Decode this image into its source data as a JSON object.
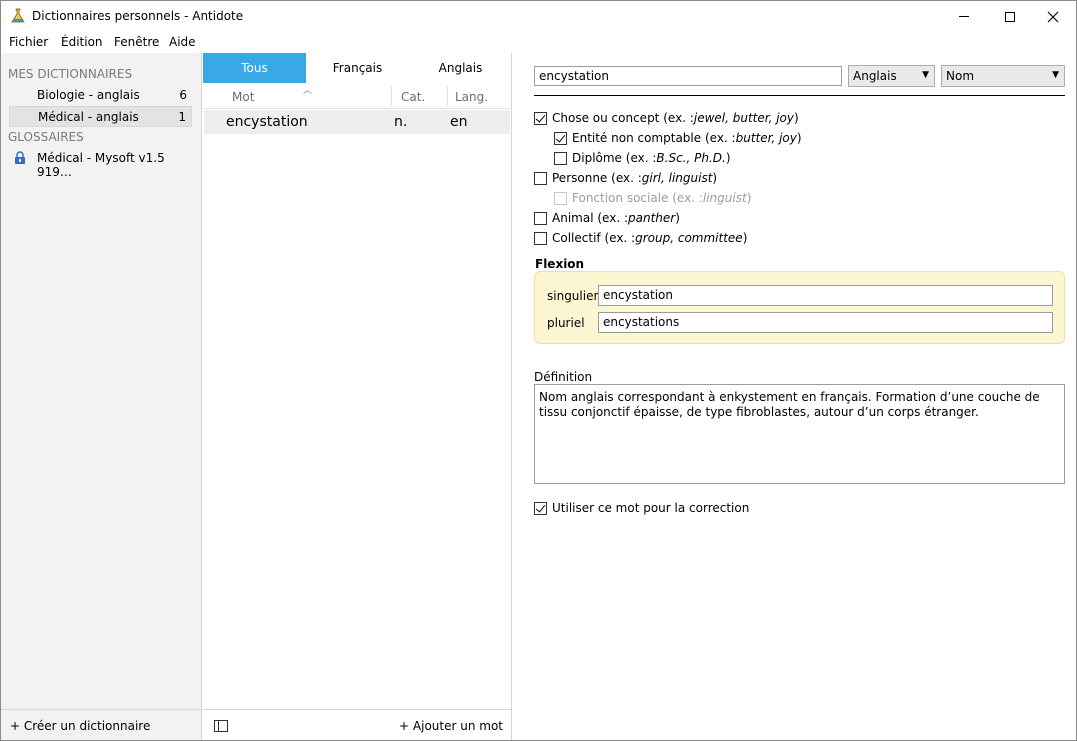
{
  "window": {
    "title": "Dictionnaires personnels - Antidote",
    "icon": "antidote-flask-icon"
  },
  "menu": {
    "fichier": "Fichier",
    "edition": "Édition",
    "fenetre": "Fenêtre",
    "aide": "Aide"
  },
  "sidebar": {
    "mes_dictionnaires_label": "MES DICTIONNAIRES",
    "dictionaries": [
      {
        "label": "Biologie - anglais",
        "count": "6"
      },
      {
        "label": "Médical - anglais",
        "count": "1"
      }
    ],
    "glossaires_label": "GLOSSAIRES",
    "glossaries": [
      {
        "label": "Médical - Mysoft v1.5  919…",
        "icon": "lock-icon"
      }
    ],
    "create_label": "+ Créer un dictionnaire"
  },
  "wordlist": {
    "tabs": [
      "Tous",
      "Français",
      "Anglais"
    ],
    "columns": {
      "mot": "Mot",
      "cat": "Cat.",
      "lang": "Lang."
    },
    "rows": [
      {
        "mot": "encystation",
        "cat": "n.",
        "lang": "en"
      }
    ],
    "add_label": "+ Ajouter un mot"
  },
  "detail": {
    "word": "encystation",
    "language": "Anglais",
    "category": "Nom",
    "semantic": {
      "chose": {
        "label": "Chose ou concept",
        "ex_prefix": "(ex. : ",
        "ex": "jewel, butter, joy",
        "ex_suffix": ")",
        "checked": true
      },
      "entite": {
        "label": "Entité non comptable",
        "ex_prefix": "(ex. : ",
        "ex": "butter, joy",
        "ex_suffix": ")",
        "checked": true
      },
      "diplome": {
        "label": "Diplôme",
        "ex_prefix": "(ex. : ",
        "ex": "B.Sc., Ph.D.",
        "ex_suffix": ")",
        "checked": false
      },
      "personne": {
        "label": "Personne",
        "ex_prefix": "(ex. : ",
        "ex": "girl, linguist",
        "ex_suffix": ")",
        "checked": false
      },
      "fonction": {
        "label": "Fonction sociale",
        "ex_prefix": "(ex. : ",
        "ex": "linguist",
        "ex_suffix": ")",
        "checked": false
      },
      "animal": {
        "label": "Animal",
        "ex_prefix": "(ex. : ",
        "ex": "panther",
        "ex_suffix": ")",
        "checked": false
      },
      "collectif": {
        "label": "Collectif",
        "ex_prefix": "(ex. : ",
        "ex": "group, committee",
        "ex_suffix": ")",
        "checked": false
      }
    },
    "flexion": {
      "title": "Flexion",
      "singulier_label": "singulier",
      "singulier": "encystation",
      "pluriel_label": "pluriel",
      "pluriel": "encystations"
    },
    "definition": {
      "title": "Définition",
      "text": "Nom anglais correspondant à enkystement en français. Formation d’une couche de tissu conjonctif épaisse, de type fibroblastes, autour d’un corps étranger."
    },
    "use_for_correction": {
      "label": "Utiliser ce mot pour la correction",
      "checked": true
    }
  },
  "colors": {
    "active_tab": "#39a9e6",
    "flexion_bg": "#fdf6d3",
    "sidebar_bg": "#f2f2f2"
  }
}
